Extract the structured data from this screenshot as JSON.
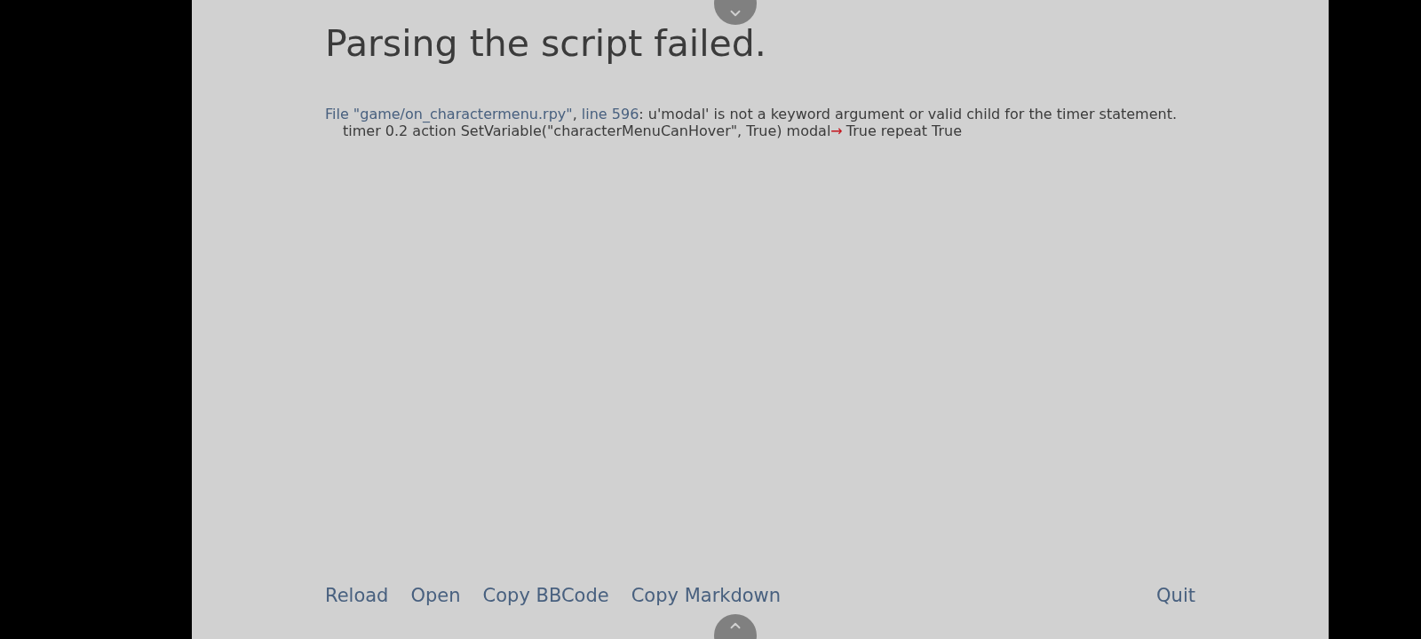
{
  "title": "Parsing the script failed.",
  "error": {
    "file_link": "File \"game/on_charactermenu.rpy\"",
    "separator": ",",
    "line_link": "line 596",
    "message": ": u'modal' is not a keyword argument or valid child for the timer statement."
  },
  "code": {
    "before": "timer 0.2 action SetVariable(\"characterMenuCanHover\", True) modal",
    "marker": "→",
    "after": "True repeat True"
  },
  "actions": [
    {
      "label": "Reload"
    },
    {
      "label": "Open"
    },
    {
      "label": "Copy BBCode"
    },
    {
      "label": "Copy Markdown"
    }
  ],
  "quit": {
    "label": "Quit"
  }
}
